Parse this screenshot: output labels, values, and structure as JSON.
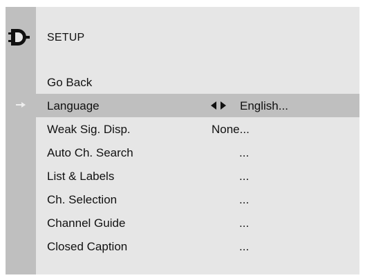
{
  "header": {
    "icon": "plug-connector-icon",
    "title": "SETUP"
  },
  "menu": {
    "items": [
      {
        "label": "Go Back",
        "value": ""
      },
      {
        "label": "Language",
        "value": "English...",
        "selected": true,
        "adjust_icon": "left-right-arrows-icon"
      },
      {
        "label": "Weak Sig. Disp.",
        "value": "None..."
      },
      {
        "label": "Auto Ch. Search",
        "value": "..."
      },
      {
        "label": "List & Labels",
        "value": "..."
      },
      {
        "label": "Ch. Selection",
        "value": "..."
      },
      {
        "label": "Channel Guide",
        "value": "..."
      },
      {
        "label": "Closed Caption",
        "value": "..."
      }
    ]
  },
  "selection_indicator_icon": "right-arrow-icon",
  "colors": {
    "panel_background": "#e6e6e6",
    "left_bar": "#bfbfbf",
    "highlight_row": "#bfbfbf",
    "text": "#111111",
    "selection_arrow": "#eeeeee"
  }
}
